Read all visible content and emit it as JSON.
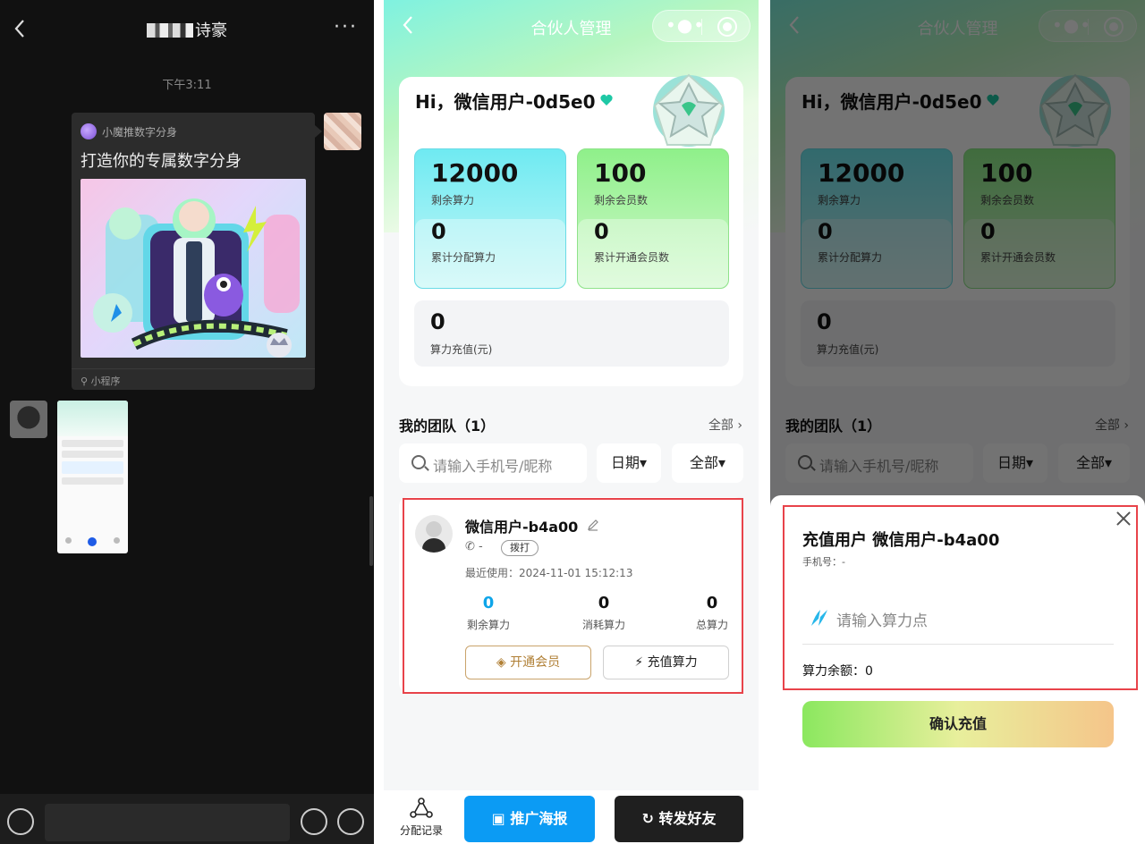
{
  "chat": {
    "title": "诗豪",
    "more": "···",
    "time": "下午3:11",
    "mini_program": {
      "source": "小魔推数字分身",
      "title": "打造你的专属数字分身",
      "footer": "小程序"
    }
  },
  "app": {
    "nav_title": "合伙人管理",
    "greeting": "Hi，微信用户-0d5e0",
    "stats": {
      "remaining_compute": "12000",
      "remaining_compute_label": "剩余算力",
      "remaining_members": "100",
      "remaining_members_label": "剩余会员数",
      "allocated_compute": "0",
      "allocated_compute_label": "累计分配算力",
      "opened_members": "0",
      "opened_members_label": "累计开通会员数",
      "recharge": "0",
      "recharge_label": "算力充值(元)"
    },
    "team": {
      "title": "我的团队（1）",
      "all_link": "全部",
      "search_placeholder": "请输入手机号/昵称",
      "filter_date": "日期▾",
      "filter_all": "全部▾"
    },
    "member": {
      "name": "微信用户-b4a00",
      "phone": "-",
      "call_label": "拨打",
      "last_used": "最近使用：2024-11-01 15:12:13",
      "remaining": "0",
      "remaining_label": "剩余算力",
      "consumed": "0",
      "consumed_label": "消耗算力",
      "total": "0",
      "total_label": "总算力",
      "vip_button": "开通会员",
      "charge_button": "充值算力"
    },
    "tabbar": {
      "record": "分配记录",
      "poster": "推广海报",
      "share": "转发好友"
    }
  },
  "recharge_sheet": {
    "title": "充值用户 微信用户-b4a00",
    "phone": "手机号：-",
    "input_placeholder": "请输入算力点",
    "balance": "算力余额：0",
    "confirm": "确认充值"
  },
  "colors": {
    "chat_bg": "#111111",
    "accent_blue": "#0b9bf4",
    "highlight_red": "#e8434a",
    "vip_gold": "#b07f35"
  }
}
